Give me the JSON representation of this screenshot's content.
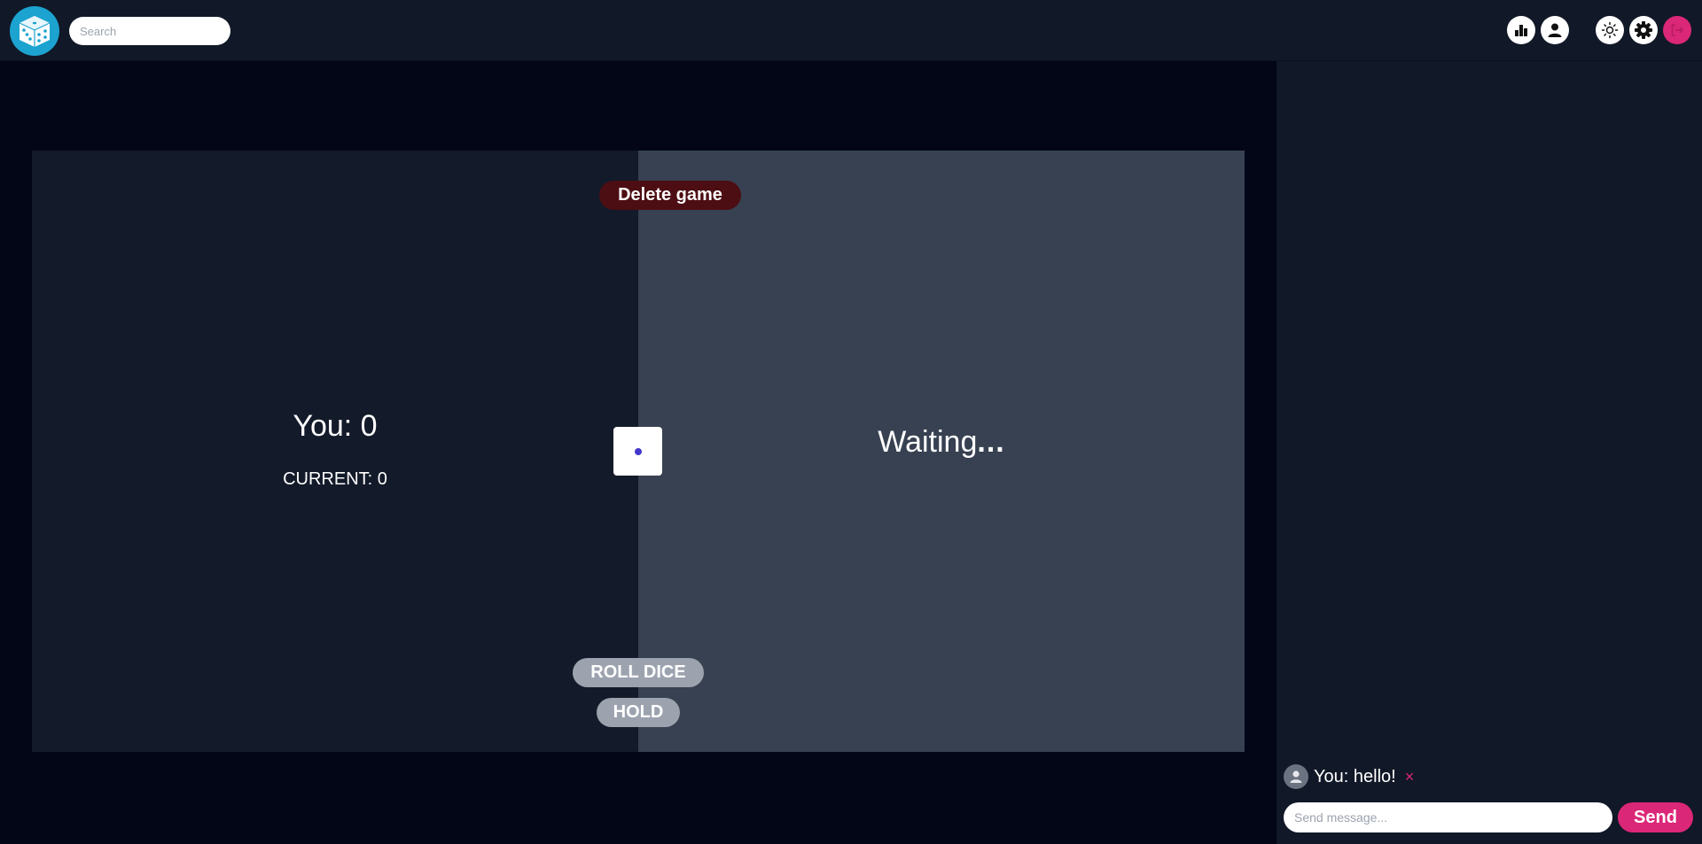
{
  "header": {
    "logo_icon": "dice-logo-icon",
    "search_placeholder": "Search",
    "buttons": [
      {
        "icon": "leaderboard-icon"
      },
      {
        "icon": "user-icon"
      },
      {
        "icon": "sun-icon"
      },
      {
        "icon": "gear-icon"
      },
      {
        "icon": "logout-icon"
      }
    ]
  },
  "game": {
    "delete_label": "Delete game",
    "you_score": "You: 0",
    "current_score": "CURRENT: 0",
    "waiting_text": "Waiting",
    "waiting_dots": "...",
    "die_value": 1,
    "roll_label": "ROLL DICE",
    "hold_label": "HOLD"
  },
  "chat": {
    "messages": [
      {
        "author": "You:",
        "text": "hello!",
        "delete_icon": "×"
      }
    ],
    "input_placeholder": "Send message...",
    "send_label": "Send"
  },
  "colors": {
    "brand_pink": "#db2777",
    "logo_blue": "#1ca3cf",
    "delete_red": "#4c0e13"
  }
}
